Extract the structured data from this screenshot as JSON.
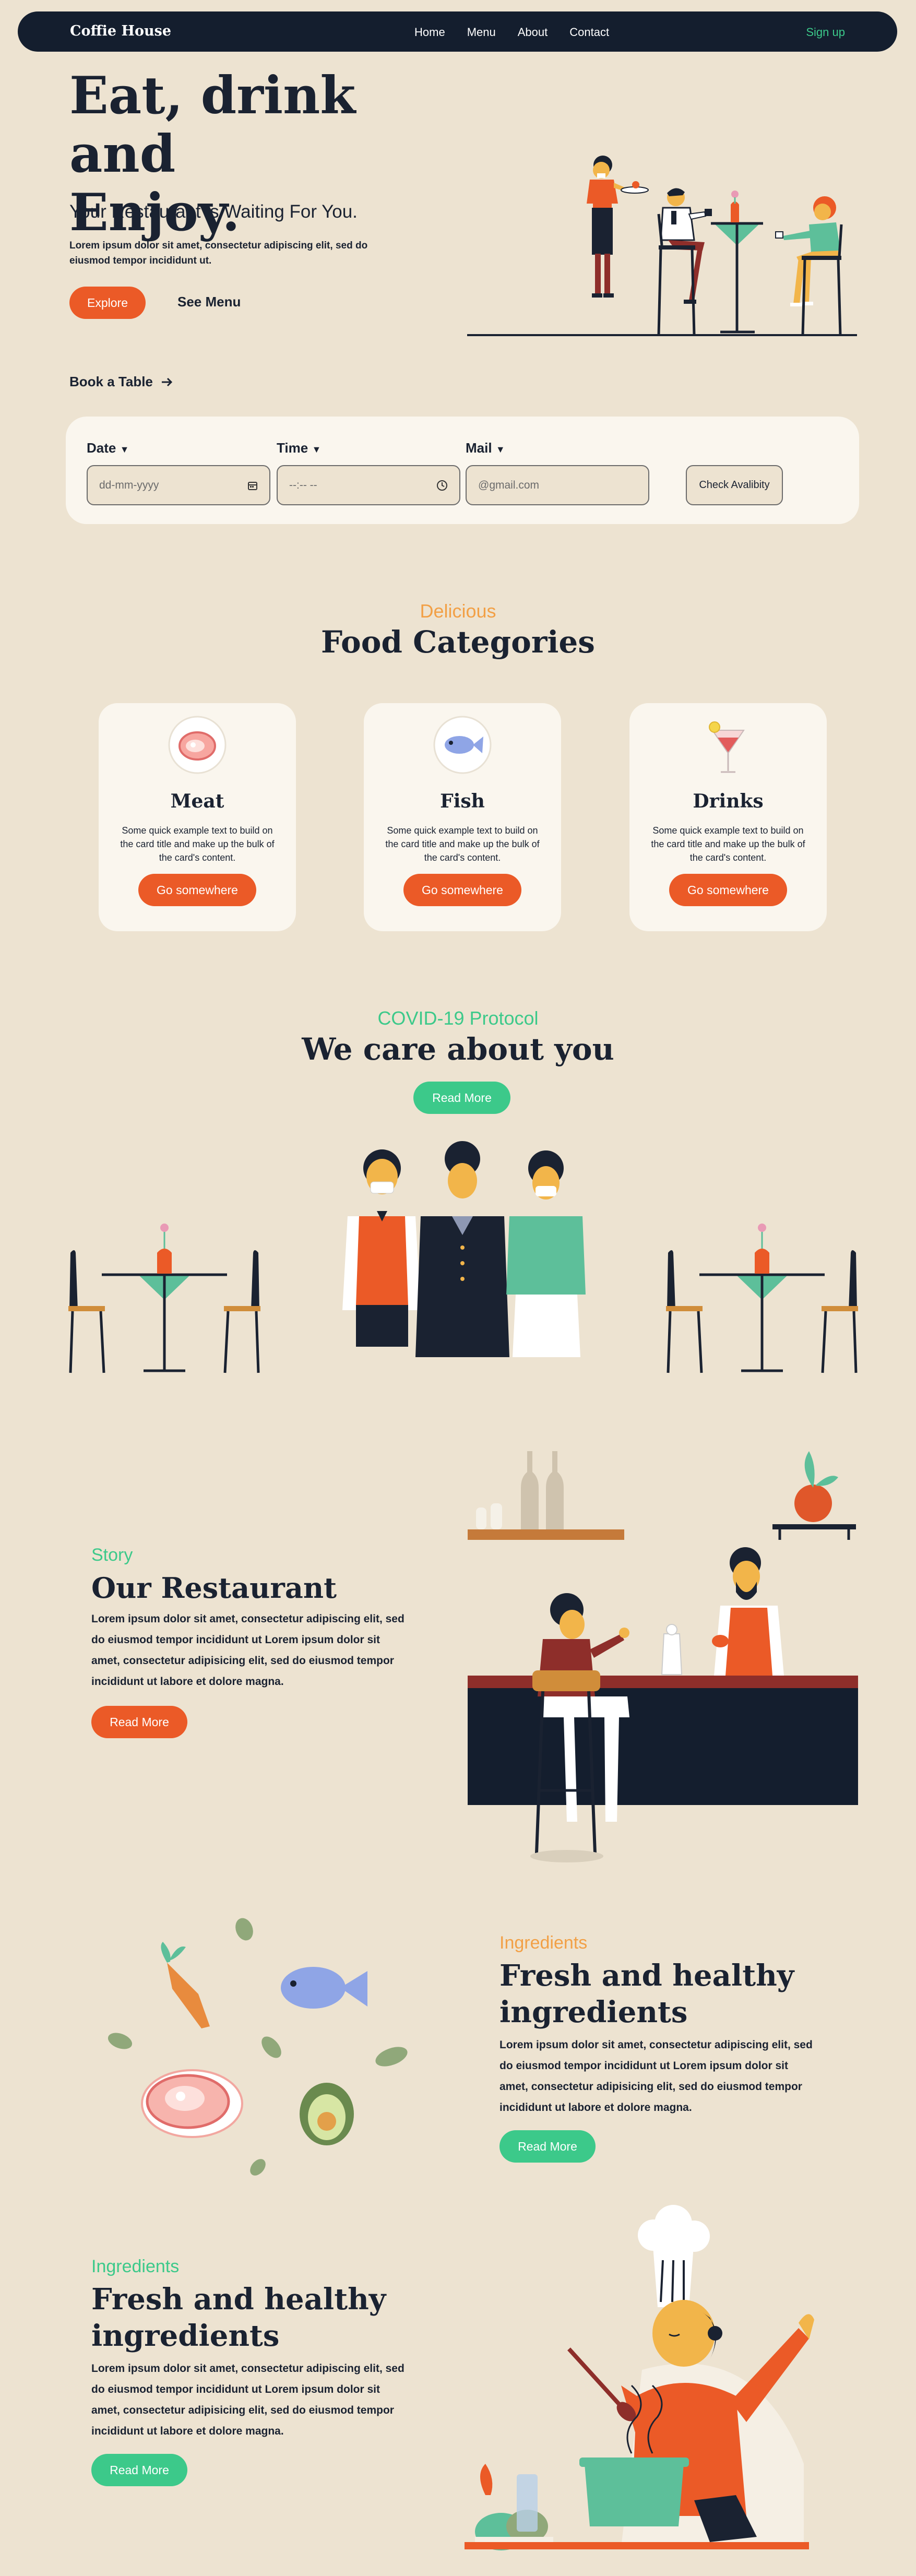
{
  "nav": {
    "brand": "Coffie House",
    "links": [
      "Home",
      "Menu",
      "About",
      "Contact"
    ],
    "signup": "Sign up"
  },
  "hero": {
    "title_line1": "Eat, drink and",
    "title_line2": "Enjoy.",
    "subtitle": "Your Restaurant is Waiting For You.",
    "lorem": "Lorem ipsum dolor sit amet, consectetur adipiscing elit, sed do eiusmod tempor incididunt ut.",
    "explore": "Explore",
    "see_menu": "See Menu"
  },
  "booking": {
    "heading": "Book a Table",
    "date_label": "Date",
    "date_placeholder": "dd-mm-yyyy",
    "time_label": "Time",
    "time_placeholder": "--:-- --",
    "mail_label": "Mail",
    "mail_placeholder": "@gmail.com",
    "check": "Check Avalibity"
  },
  "categories": {
    "kicker": "Delicious",
    "title": "Food Categories",
    "cards": [
      {
        "title": "Meat",
        "text": "Some quick example text to build on the card title and make up the bulk of the card's content.",
        "button": "Go somewhere"
      },
      {
        "title": "Fish",
        "text": "Some quick example text to build on the card title and make up the bulk of the card's content.",
        "button": "Go somewhere"
      },
      {
        "title": "Drinks",
        "text": "Some quick example text to build on the card title and make up the bulk of the card's content.",
        "button": "Go somewhere"
      }
    ]
  },
  "covid": {
    "kicker": "COVID-19 Protocol",
    "title": "We care about you",
    "button": "Read More"
  },
  "story": {
    "kicker": "Story",
    "title": "Our Restaurant",
    "text": "Lorem ipsum dolor sit amet, consectetur adipiscing elit, sed do eiusmod tempor incididunt ut Lorem ipsum dolor sit amet, consectetur adipisicing elit, sed do eiusmod tempor incididunt ut labore et dolore magna.",
    "button": "Read More"
  },
  "ingredients1": {
    "kicker": "Ingredients",
    "title_line1": "Fresh and healthy",
    "title_line2": "ingredients",
    "text": "Lorem ipsum dolor sit amet, consectetur adipiscing elit, sed do eiusmod tempor incididunt ut Lorem ipsum dolor sit amet, consectetur adipisicing elit, sed do eiusmod tempor incididunt ut labore et dolore magna.",
    "button": "Read More"
  },
  "ingredients2": {
    "kicker": "Ingredients",
    "title_line1": "Fresh and healthy",
    "title_line2": "ingredients",
    "text": "Lorem ipsum dolor sit amet, consectetur adipiscing elit, sed do eiusmod tempor incididunt ut Lorem ipsum dolor sit amet, consectetur adipisicing elit, sed do eiusmod tempor incididunt ut labore et dolore magna.",
    "button": "Read More"
  },
  "colors": {
    "background": "#ede3d1",
    "navy": "#141e2e",
    "orange": "#eb5a27",
    "green": "#3cc98a",
    "kicker_orange": "#f2a046",
    "card": "#faf6ee"
  }
}
